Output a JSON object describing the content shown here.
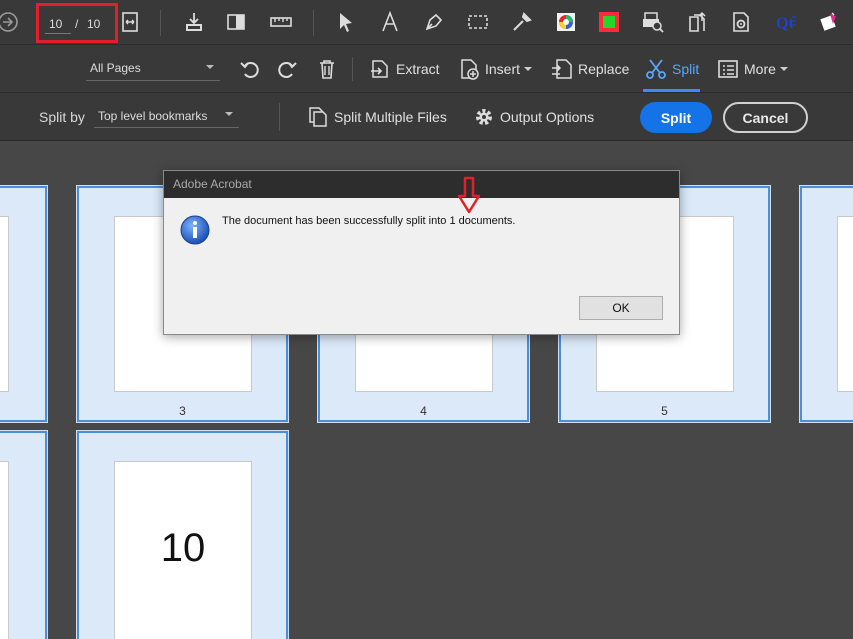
{
  "toolbar_top": {
    "current_page": "10",
    "separator": "/",
    "total_pages": "10",
    "icons": [
      "back-arrow-icon",
      "fit-width-icon",
      "save-stamp-icon",
      "highlight-box-icon",
      "ruler-icon",
      "select-arrow-icon",
      "text-tool-icon",
      "pen-tool-icon",
      "rectangle-select-icon",
      "eyedropper-icon",
      "color-wheel-icon",
      "green-square-icon",
      "print-search-icon",
      "export-icon",
      "settings-doc-icon",
      "plugin-logo-icon",
      "eraser-icon"
    ]
  },
  "toolbar_organize": {
    "page_range": "All Pages",
    "extract": "Extract",
    "insert": "Insert",
    "replace": "Replace",
    "split": "Split",
    "more": "More",
    "active_color": "#5aa6ff"
  },
  "toolbar_split": {
    "split_by_label": "Split by",
    "split_by_value": "Top level bookmarks",
    "split_multiple": "Split Multiple Files",
    "output_options": "Output Options",
    "split_button": "Split",
    "cancel_button": "Cancel",
    "accent": "#1473e6"
  },
  "thumbnails": {
    "page3": "3",
    "page4": "4",
    "page5": "5",
    "page10_big": "10"
  },
  "dialog": {
    "title": "Adobe Acrobat",
    "message": "The document has been successfully split into 1 documents.",
    "ok": "OK"
  }
}
